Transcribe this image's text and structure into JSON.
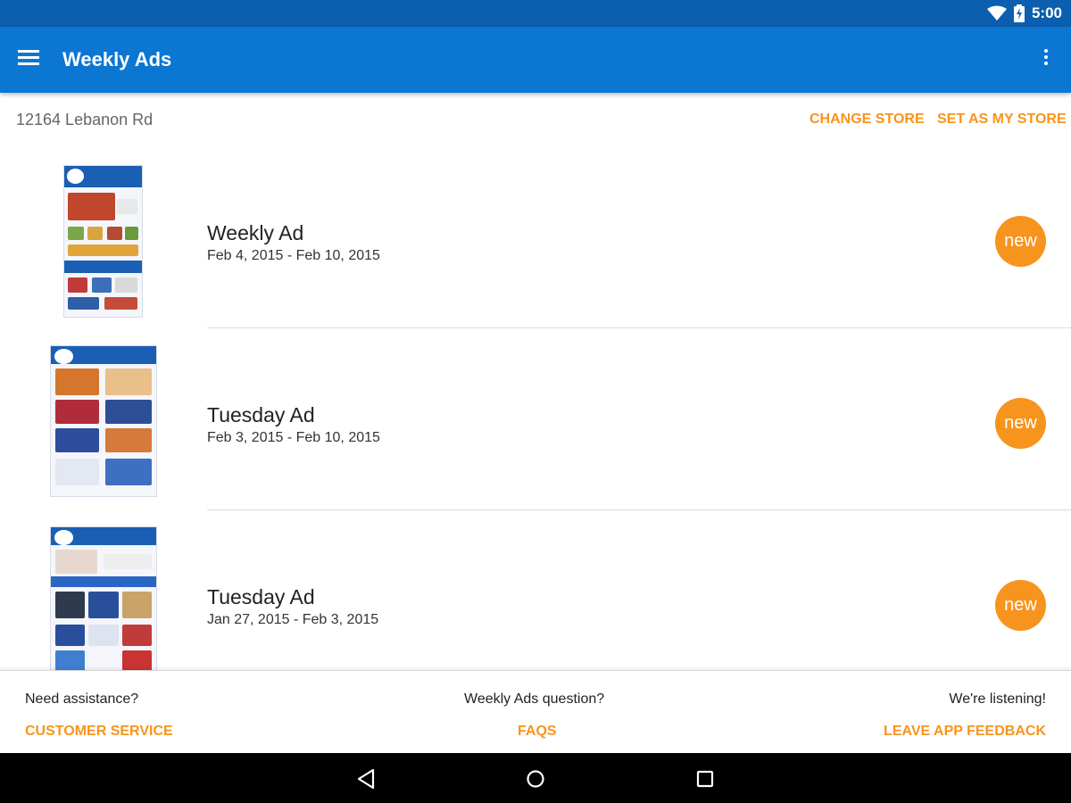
{
  "status_bar": {
    "time": "5:00",
    "icons": [
      "wifi-icon",
      "battery-charging-icon"
    ],
    "background": "#0b5fae"
  },
  "app_bar": {
    "menu_icon": "hamburger-menu-icon",
    "title": "Weekly Ads",
    "overflow_icon": "more-vert-icon",
    "background": "#0b77d3"
  },
  "store": {
    "address": "12164 Lebanon Rd",
    "change_store_label": "CHANGE STORE",
    "set_my_store_label": "SET AS MY STORE"
  },
  "ads": [
    {
      "name": "Weekly Ad",
      "dates": "Feb 4, 2015 - Feb 10, 2015",
      "badge": "new"
    },
    {
      "name": "Tuesday Ad",
      "dates": "Feb 3, 2015 - Feb 10, 2015",
      "badge": "new"
    },
    {
      "name": "Tuesday Ad",
      "dates": "Jan 27, 2015 - Feb 3, 2015",
      "badge": "new"
    }
  ],
  "footer": {
    "assistance_question": "Need assistance?",
    "customer_service_label": "CUSTOMER SERVICE",
    "ads_question": "Weekly Ads question?",
    "faqs_label": "FAQS",
    "listening_text": "We're listening!",
    "feedback_label": "LEAVE APP FEEDBACK"
  },
  "nav_bar": {
    "icons": [
      "back-icon",
      "home-icon",
      "recents-icon"
    ]
  },
  "colors": {
    "accent": "#f7941d",
    "primary": "#0b77d3",
    "primary_dark": "#0b5fae"
  }
}
